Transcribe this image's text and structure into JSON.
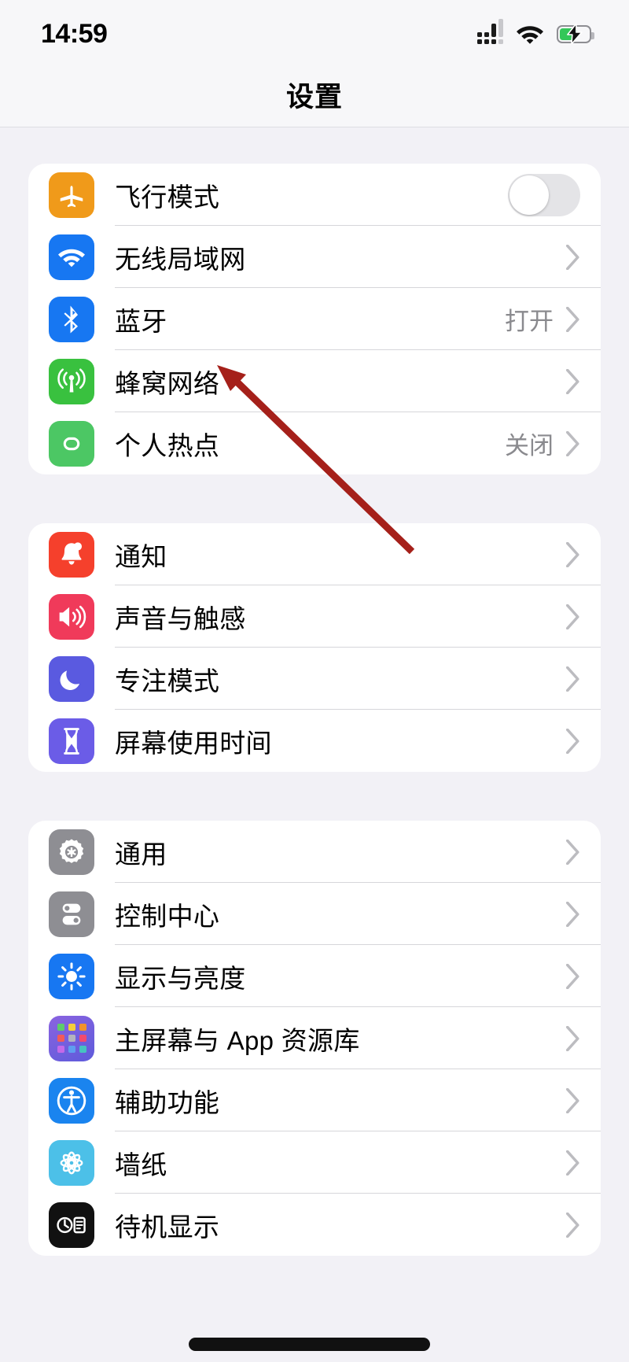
{
  "status_bar": {
    "time": "14:59",
    "signal_icon": "cellular-signal-icon",
    "wifi_icon": "wifi-icon",
    "battery_icon": "battery-charging-icon",
    "battery_color": "#34c759",
    "battery_charging": true
  },
  "header": {
    "title": "设置"
  },
  "groups": [
    {
      "rows": [
        {
          "label": "飞行模式",
          "icon": "airplane-icon",
          "icon_color": "#f09a1a",
          "control": "toggle",
          "toggle_on": false,
          "value": ""
        },
        {
          "label": "无线局域网",
          "icon": "wifi-icon",
          "icon_color": "#1777f2",
          "control": "chevron",
          "value": ""
        },
        {
          "label": "蓝牙",
          "icon": "bluetooth-icon",
          "icon_color": "#1777f2",
          "control": "chevron",
          "value": "打开"
        },
        {
          "label": "蜂窝网络",
          "icon": "cellular-icon",
          "icon_color": "#39c13f",
          "control": "chevron",
          "value": ""
        },
        {
          "label": "个人热点",
          "icon": "personal-hotspot-icon",
          "icon_color": "#4cc764",
          "control": "chevron",
          "value": "关闭"
        }
      ]
    },
    {
      "rows": [
        {
          "label": "通知",
          "icon": "bell-icon",
          "icon_color": "#f5402c",
          "control": "chevron",
          "value": ""
        },
        {
          "label": "声音与触感",
          "icon": "speaker-icon",
          "icon_color": "#f03a5a",
          "control": "chevron",
          "value": ""
        },
        {
          "label": "专注模式",
          "icon": "moon-icon",
          "icon_color": "#5a5ae0",
          "control": "chevron",
          "value": ""
        },
        {
          "label": "屏幕使用时间",
          "icon": "hourglass-icon",
          "icon_color": "#6b5ce7",
          "control": "chevron",
          "value": ""
        }
      ]
    },
    {
      "rows": [
        {
          "label": "通用",
          "icon": "gear-icon",
          "icon_color": "#8e8e93",
          "control": "chevron",
          "value": ""
        },
        {
          "label": "控制中心",
          "icon": "sliders-icon",
          "icon_color": "#8e8e93",
          "control": "chevron",
          "value": ""
        },
        {
          "label": "显示与亮度",
          "icon": "brightness-icon",
          "icon_color": "#1777f2",
          "control": "chevron",
          "value": ""
        },
        {
          "label": "主屏幕与 App 资源库",
          "icon": "home-screen-grid-icon",
          "icon_color": "#6f5bd6",
          "control": "chevron",
          "value": ""
        },
        {
          "label": "辅助功能",
          "icon": "accessibility-icon",
          "icon_color": "#1a84ef",
          "control": "chevron",
          "value": ""
        },
        {
          "label": "墙纸",
          "icon": "wallpaper-flower-icon",
          "icon_color": "#4cc0e8",
          "control": "chevron",
          "value": ""
        },
        {
          "label": "待机显示",
          "icon": "standby-icon",
          "icon_color": "#111111",
          "control": "chevron",
          "value": ""
        }
      ]
    }
  ],
  "annotations": {
    "arrow_color": "#a5201a",
    "arrow_target": "蜂窝网络",
    "redaction_color": "#111111"
  }
}
